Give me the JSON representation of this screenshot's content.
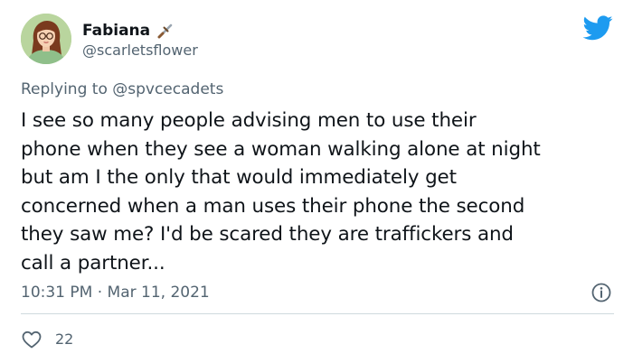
{
  "author": {
    "display_name": "Fabiana",
    "handle": "@scarletsflower",
    "avatar_icon": "cartoon-avatar",
    "name_emoji": "dagger-emoji"
  },
  "reply": {
    "prefix": "Replying to ",
    "mention": "@spvcecadets"
  },
  "tweet": {
    "text": "I see so many people advising men to use their\nphone when they see a woman walking alone at night\nbut am I the only that would immediately get\nconcerned when a man uses their phone the second\nthey saw me? I'd be scared they are traffickers and\ncall a partner...",
    "timestamp": "10:31 PM · Mar 11, 2021"
  },
  "stats": {
    "likes": "22"
  },
  "icons": {
    "brand": "twitter-bird-icon",
    "info": "info-icon",
    "like": "heart-icon"
  },
  "colors": {
    "brand_blue": "#1d9bf0",
    "text_primary": "#0f1419",
    "text_secondary": "#536471",
    "divider": "#cfd9de"
  }
}
